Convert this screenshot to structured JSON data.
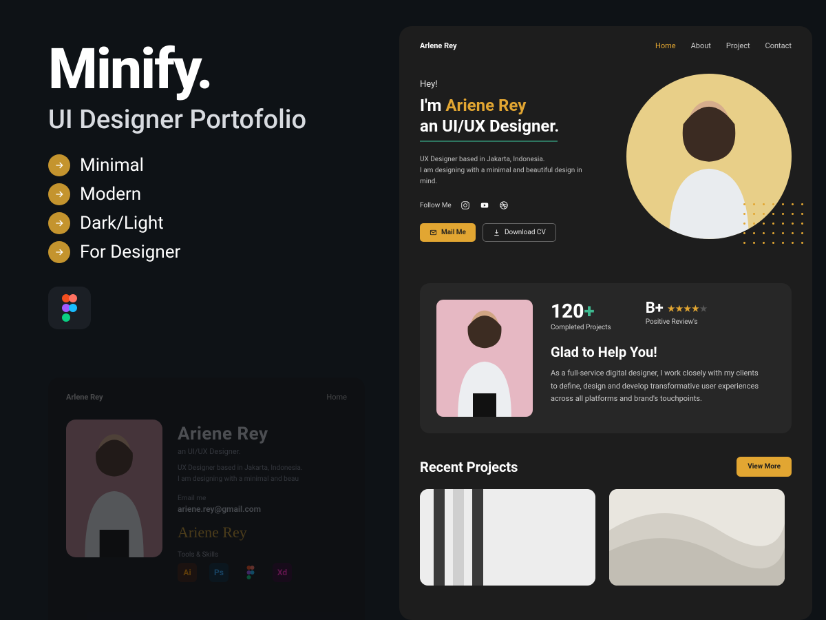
{
  "promo": {
    "title": "Minify.",
    "subtitle": "UI Designer Portofolio",
    "features": [
      "Minimal",
      "Modern",
      "Dark/Light",
      "For Designer"
    ]
  },
  "right_window": {
    "brand": "Arlene Rey",
    "nav": {
      "home": "Home",
      "about": "About",
      "project": "Project",
      "contact": "Contact"
    },
    "hero": {
      "hey": "Hey!",
      "line1_prefix": "I'm ",
      "line1_name": "Ariene  Rey",
      "line2": "an UI/UX Designer.",
      "desc_l1": "UX Designer based in Jakarta, Indonesia.",
      "desc_l2": "I am designing with a minimal and beautiful design in mind.",
      "follow": "Follow Me",
      "mail_btn": "Mail Me",
      "cv_btn": "Download CV"
    },
    "stats": {
      "count": "120",
      "plus": "+",
      "count_label": "Completed Projects",
      "grade": "B+",
      "grade_label": "Positive Review's",
      "glad": "Glad to Help You!",
      "glad_desc": "As a full-service digital designer, I work closely with my clients to define, design and develop transformative user experiences across all platforms and brand's touchpoints."
    },
    "recent": {
      "title": "Recent Projects",
      "viewmore": "View More"
    }
  },
  "lower_preview": {
    "brand": "Arlene Rey",
    "nav_home": "Home",
    "name": "Ariene  Rey",
    "role": "an UI/UX Designer.",
    "desc_l1": "UX Designer based in Jakarta, Indonesia.",
    "desc_l2": "I am designing with a minimal and beau",
    "email_label": "Email me",
    "email": "ariene.rey@gmail.com",
    "signature": "Ariene Rey",
    "tools_label": "Tools & Skills",
    "tool_ai": "Ai",
    "tool_ps": "Ps",
    "tool_xd": "Xd"
  },
  "colors": {
    "accent": "#e2a632",
    "bg": "#0e1216",
    "card": "#272727"
  }
}
